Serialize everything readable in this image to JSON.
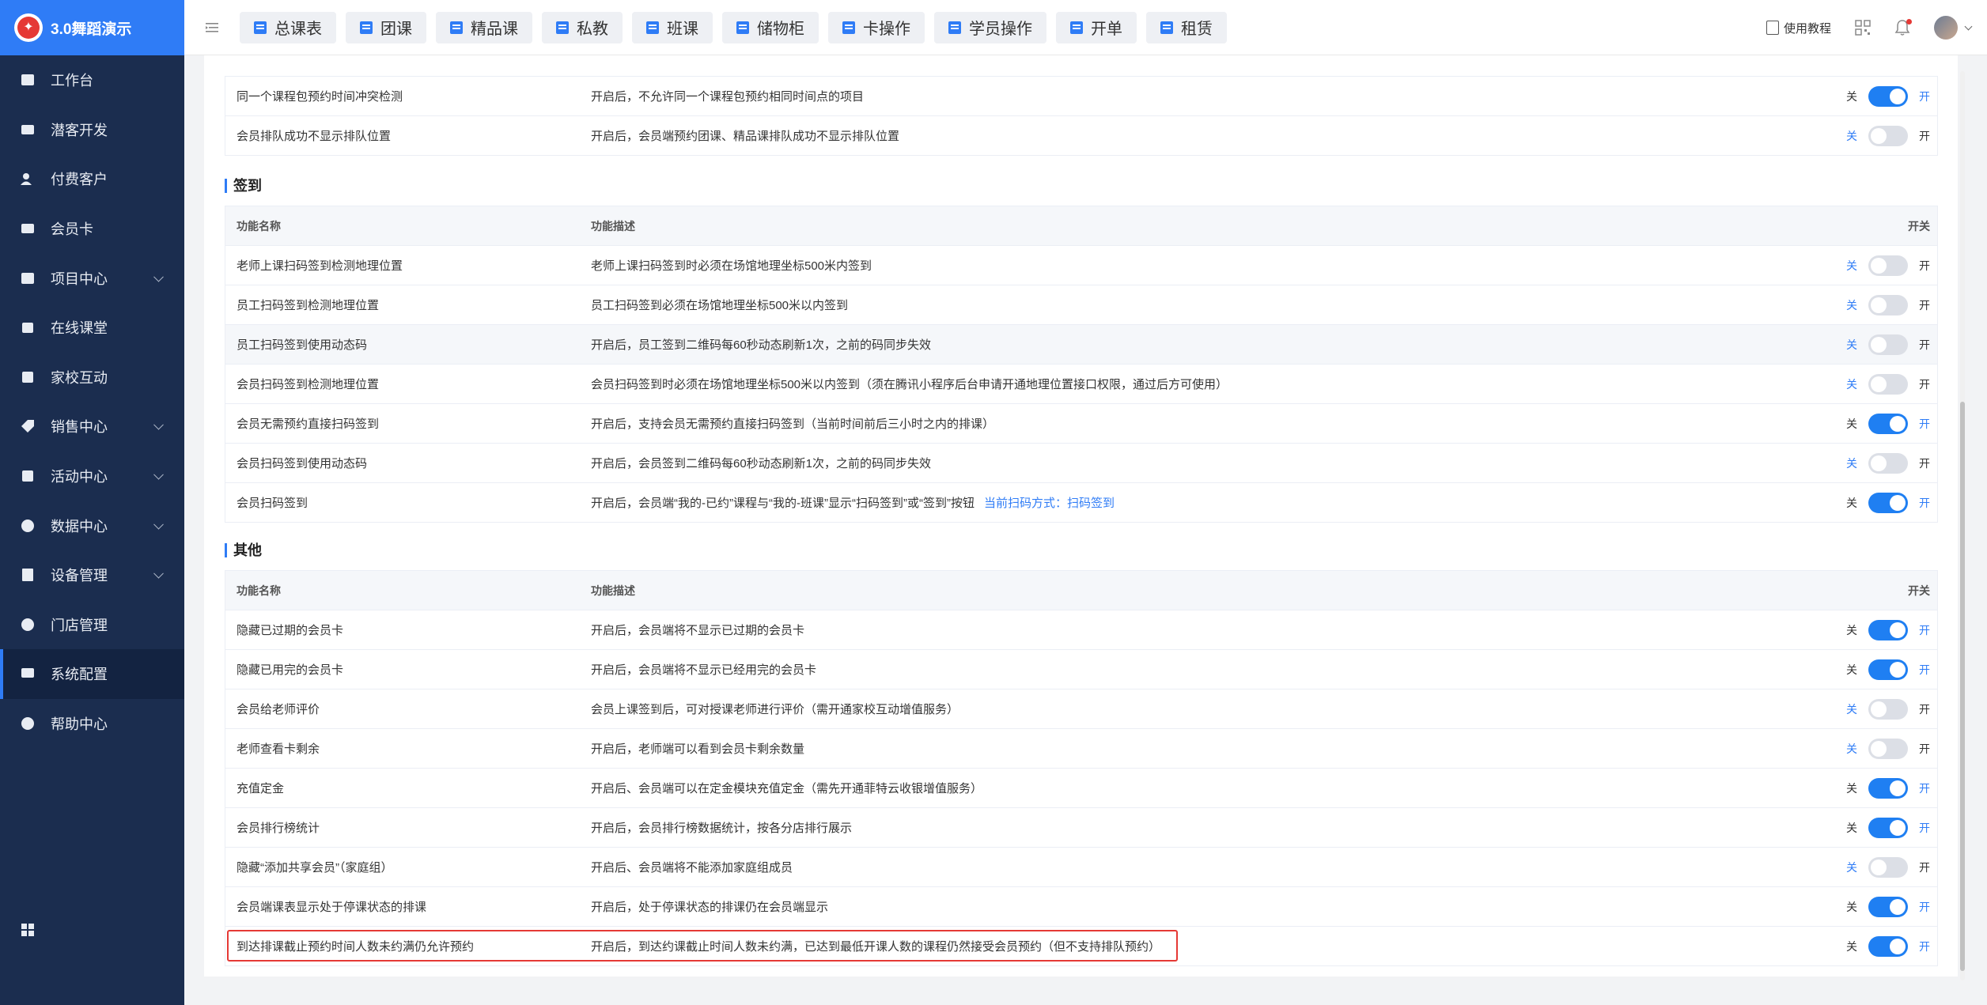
{
  "brand": {
    "title": "3.0舞蹈演示"
  },
  "sidebar": {
    "items": [
      {
        "label": "工作台",
        "icon": "image-icon",
        "has_children": false
      },
      {
        "label": "潜客开发",
        "icon": "id-card-icon",
        "has_children": false
      },
      {
        "label": "付费客户",
        "icon": "users-icon",
        "has_children": false
      },
      {
        "label": "会员卡",
        "icon": "card-icon",
        "has_children": false
      },
      {
        "label": "项目中心",
        "icon": "list-icon",
        "has_children": true
      },
      {
        "label": "在线课堂",
        "icon": "calendar-icon",
        "has_children": false
      },
      {
        "label": "家校互动",
        "icon": "contact-icon",
        "has_children": false
      },
      {
        "label": "销售中心",
        "icon": "tag-icon",
        "has_children": true
      },
      {
        "label": "活动中心",
        "icon": "flag-icon",
        "has_children": true
      },
      {
        "label": "数据中心",
        "icon": "pie-icon",
        "has_children": true
      },
      {
        "label": "设备管理",
        "icon": "device-icon",
        "has_children": true
      },
      {
        "label": "门店管理",
        "icon": "store-icon",
        "has_children": false
      },
      {
        "label": "系统配置",
        "icon": "settings-icon",
        "has_children": false,
        "active": true
      },
      {
        "label": "帮助中心",
        "icon": "help-icon",
        "has_children": false
      }
    ]
  },
  "topbar": {
    "tabs": [
      "总课表",
      "团课",
      "精品课",
      "私教",
      "班课",
      "储物柜",
      "卡操作",
      "学员操作",
      "开单",
      "租赁"
    ],
    "tutorial_label": "使用教程"
  },
  "sections": {
    "partial": {
      "rows": [
        {
          "name": "同一个课程包预约时间冲突检测",
          "desc": "开启后，不允许同一个课程包预约相同时间点的项目",
          "on": true
        },
        {
          "name": "会员排队成功不显示排队位置",
          "desc": "开启后，会员端预约团课、精品课排队成功不显示排队位置",
          "on": false
        }
      ]
    },
    "checkin": {
      "title": "签到",
      "rows": [
        {
          "name": "老师上课扫码签到检测地理位置",
          "desc": "老师上课扫码签到时必须在场馆地理坐标500米内签到",
          "on": false
        },
        {
          "name": "员工扫码签到检测地理位置",
          "desc": "员工扫码签到必须在场馆地理坐标500米以内签到",
          "on": false
        },
        {
          "name": "员工扫码签到使用动态码",
          "desc": "开启后，员工签到二维码每60秒动态刷新1次，之前的码同步失效",
          "on": false
        },
        {
          "name": "会员扫码签到检测地理位置",
          "desc": "会员扫码签到时必须在场馆地理坐标500米以内签到（须在腾讯小程序后台申请开通地理位置接口权限，通过后方可使用）",
          "on": false
        },
        {
          "name": "会员无需预约直接扫码签到",
          "desc": "开启后，支持会员无需预约直接扫码签到（当前时间前后三小时之内的排课）",
          "on": true
        },
        {
          "name": "会员扫码签到使用动态码",
          "desc": "开启后，会员签到二维码每60秒动态刷新1次，之前的码同步失效",
          "on": false
        },
        {
          "name": "会员扫码签到",
          "desc": "开启后，会员端“我的-已约”课程与“我的-班课”显示“扫码签到”或“签到”按钮",
          "link": "当前扫码方式：扫码签到",
          "on": true
        }
      ]
    },
    "other": {
      "title": "其他",
      "rows": [
        {
          "name": "隐藏已过期的会员卡",
          "desc": "开启后，会员端将不显示已过期的会员卡",
          "on": true
        },
        {
          "name": "隐藏已用完的会员卡",
          "desc": "开启后，会员端将不显示已经用完的会员卡",
          "on": true
        },
        {
          "name": "会员给老师评价",
          "desc": "会员上课签到后，可对授课老师进行评价（需开通家校互动增值服务）",
          "on": false
        },
        {
          "name": "老师查看卡剩余",
          "desc": "开启后，老师端可以看到会员卡剩余数量",
          "on": false
        },
        {
          "name": "充值定金",
          "desc": "开启后、会员端可以在定金模块充值定金（需先开通菲特云收银增值服务）",
          "on": true
        },
        {
          "name": "会员排行榜统计",
          "desc": "开启后，会员排行榜数据统计，按各分店排行展示",
          "on": true
        },
        {
          "name": "隐藏“添加共享会员”（家庭组）",
          "desc": "开启后、会员端将不能添加家庭组成员",
          "on": false
        },
        {
          "name": "会员端课表显示处于停课状态的排课",
          "desc": "开启后，处于停课状态的排课仍在会员端显示",
          "on": true
        },
        {
          "name": "到达排课截止预约时间人数未约满仍允许预约",
          "desc": "开启后，到达约课截止时间人数未约满，已达到最低开课人数的课程仍然接受会员预约（但不支持排队预约）",
          "on": true
        }
      ]
    }
  },
  "table_headers": {
    "name": "功能名称",
    "desc": "功能描述",
    "switch": "开关"
  },
  "switch_labels": {
    "off": "关",
    "on": "开"
  },
  "colors": {
    "accent": "#2f7cf6",
    "sidebar": "#1b2d4f",
    "highlight": "#e53935"
  }
}
